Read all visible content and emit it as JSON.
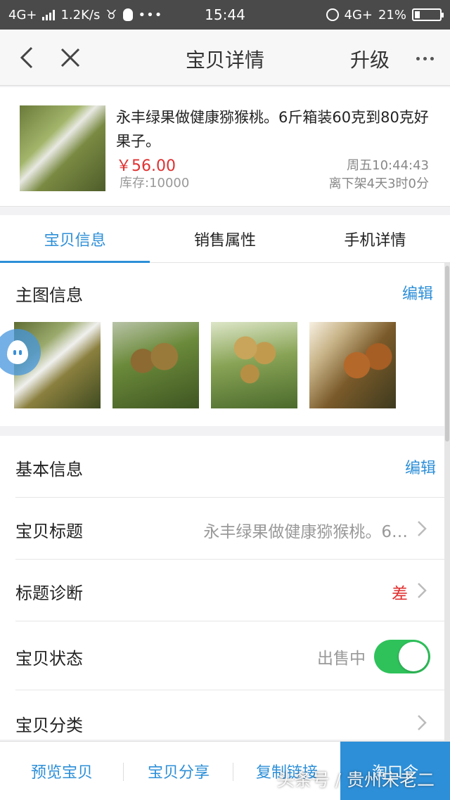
{
  "status_bar": {
    "network_left": "4G+",
    "speed": "1.2K/s",
    "time": "15:44",
    "network_right": "4G+",
    "battery": "21%",
    "battery_level": 0.21,
    "icons": [
      "signal-icon",
      "bull-icon",
      "qq-penguin-icon",
      "ellipsis-icon",
      "alarm-icon",
      "battery-icon"
    ]
  },
  "nav": {
    "title": "宝贝详情",
    "upgrade": "升级",
    "icons": [
      "back-arrow-icon",
      "close-icon",
      "more-dots-icon"
    ]
  },
  "product": {
    "title": "永丰绿果做健康猕猴桃。6斤箱装60克到80克好果子。",
    "price": "￥56.00",
    "stock": "库存:10000",
    "time": "周五10:44:43",
    "off_shelf": "离下架4天3时0分"
  },
  "tabs": [
    {
      "label": "宝贝信息",
      "active": true
    },
    {
      "label": "销售属性",
      "active": false
    },
    {
      "label": "手机详情",
      "active": false
    }
  ],
  "main_images": {
    "header": "主图信息",
    "edit": "编辑"
  },
  "basic_info": {
    "header": "基本信息",
    "edit": "编辑",
    "rows": [
      {
        "label": "宝贝标题",
        "value": "永丰绿果做健康猕猴桃。6…"
      },
      {
        "label": "标题诊断",
        "value": "差"
      },
      {
        "label": "宝贝状态",
        "value": "出售中",
        "toggle_on": true
      },
      {
        "label": "宝贝分类",
        "value": ""
      }
    ]
  },
  "bottom_bar": {
    "preview": "预览宝贝",
    "share": "宝贝分享",
    "copy_link": "复制链接",
    "taokouling": "淘口令"
  },
  "watermark": "头条号 / 贵州宋老二",
  "colors": {
    "accent": "#2d8fd8",
    "price": "#e03131",
    "toggle_on": "#2fc25b",
    "status_bar": "#4a4a4a"
  }
}
